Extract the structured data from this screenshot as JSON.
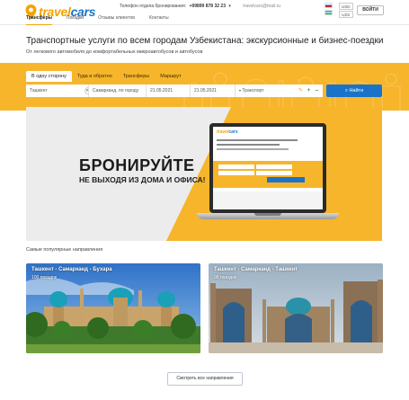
{
  "header": {
    "logo": "Travelcars",
    "contact_label": "Телефон отдела бронирования:",
    "phone": "+99899 878 32 23",
    "email": "travelcars@mail.ru",
    "currency_1": "USD",
    "currency_2": "UZS",
    "login_label": "ВОЙТИ",
    "nav": [
      "Трансферы",
      "Поездки",
      "Отзывы клиентов",
      "Контакты"
    ]
  },
  "hero": {
    "title": "Транспортные услуги по всем городам Узбекистана: экскурсионные и бизнес-поездки",
    "subtitle": "От легкового автомобиля до комфортабельных микроавтобусов и автобусов"
  },
  "search": {
    "tabs": [
      "В одну сторону",
      "Туда и обратно",
      "Трансферы",
      "Маршрут"
    ],
    "from_value": "Ташкент",
    "to_value": "Самарканд, по городу",
    "date_from": "21.05.2021",
    "date_to": "21.05.2021",
    "transport_value": "Транспорт",
    "search_button": "Найти"
  },
  "banner": {
    "headline": "БРОНИРУЙТЕ",
    "subheadline": "НЕ ВЫХОДЯ ИЗ ДОМА И ОФИСА!",
    "screen_logo": "Travelcars"
  },
  "popular": {
    "title": "Самые популярные направления",
    "cards": [
      {
        "title": "Ташкент - Самарканд - Бухара",
        "meta": "100 поездок"
      },
      {
        "title": "Ташкент - Самарканд - Ташкент",
        "meta": "98 поездок"
      }
    ],
    "all_button": "Смотреть все направления"
  },
  "colors": {
    "accent_orange": "#f7b52b",
    "brand_blue": "#1a73c9"
  }
}
